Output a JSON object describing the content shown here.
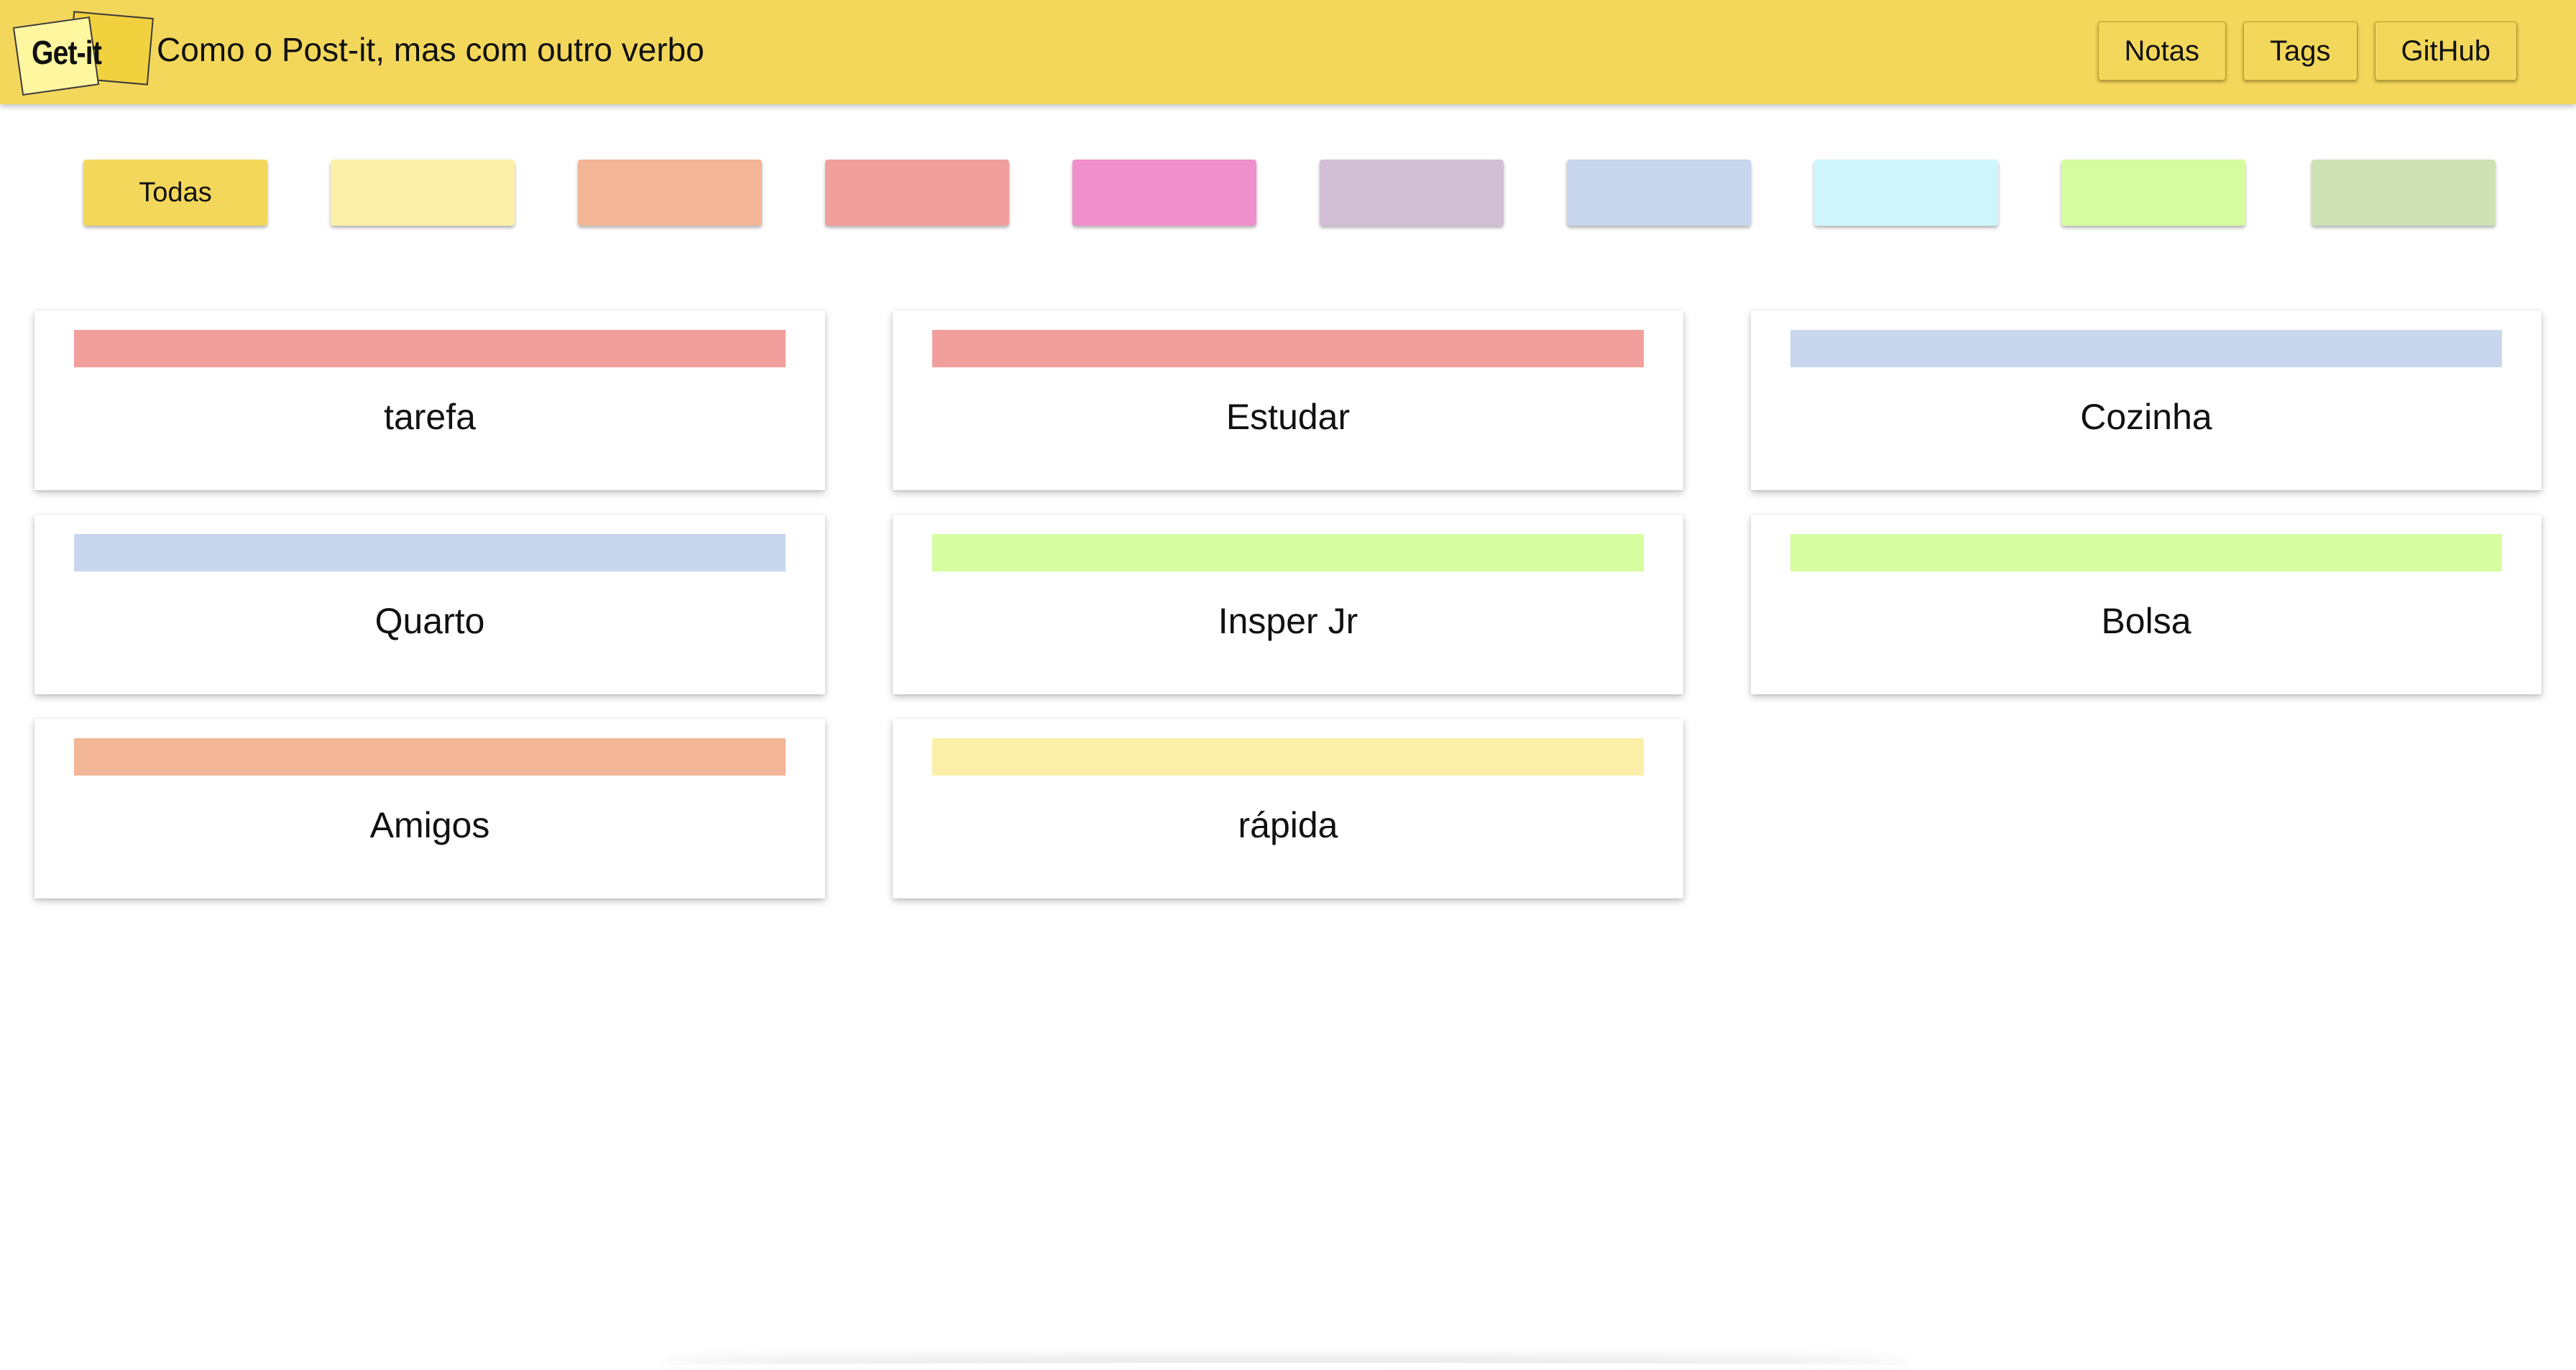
{
  "header": {
    "logo_text": "Get-it",
    "subtitle": "Como o Post-it, mas com outro verbo",
    "nav": [
      {
        "label": "Notas"
      },
      {
        "label": "Tags"
      },
      {
        "label": "GitHub"
      }
    ],
    "bg_color": "#f3d75a"
  },
  "filters": [
    {
      "label": "Todas",
      "color": "#f3d75a"
    },
    {
      "label": "",
      "color": "#fcf0a9"
    },
    {
      "label": "",
      "color": "#f3b697"
    },
    {
      "label": "",
      "color": "#f19f9c"
    },
    {
      "label": "",
      "color": "#ef90cd"
    },
    {
      "label": "",
      "color": "#d3bfd5"
    },
    {
      "label": "",
      "color": "#c8d6ee"
    },
    {
      "label": "",
      "color": "#cff6fd"
    },
    {
      "label": "",
      "color": "#d6fd9f"
    },
    {
      "label": "",
      "color": "#cee2b4"
    }
  ],
  "tags": [
    {
      "title": "tarefa",
      "color": "#f19f9c"
    },
    {
      "title": "Estudar",
      "color": "#f19f9c"
    },
    {
      "title": "Cozinha",
      "color": "#c8d6ee"
    },
    {
      "title": "Quarto",
      "color": "#c8d6ee"
    },
    {
      "title": "Insper Jr",
      "color": "#d6fd9f"
    },
    {
      "title": "Bolsa",
      "color": "#d6fd9f"
    },
    {
      "title": "Amigos",
      "color": "#f3b697"
    },
    {
      "title": "rápida",
      "color": "#fcf0a9"
    }
  ]
}
